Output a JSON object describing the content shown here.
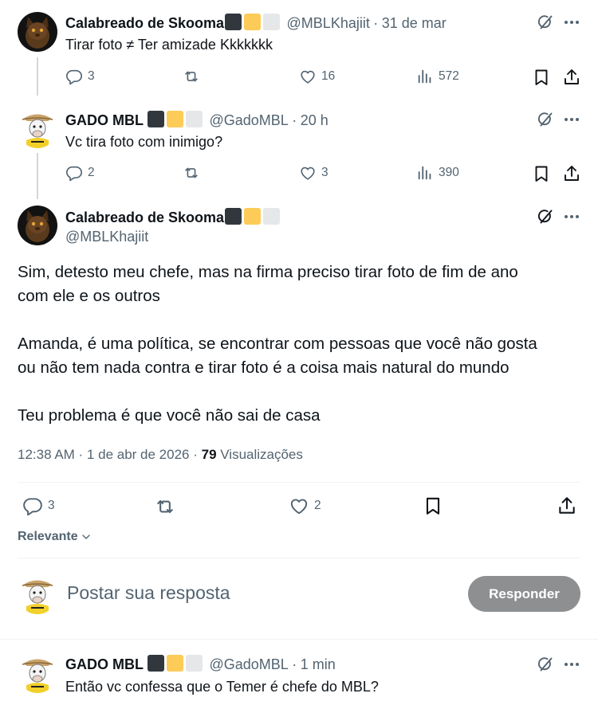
{
  "tweets": [
    {
      "author": "Calabreado de Skooma",
      "handle": "@MBLKhajiit",
      "dot": "·",
      "time": "31 de mar",
      "text": "Tirar foto ≠ Ter amizade Kkkkkkk",
      "replies": "3",
      "likes": "16",
      "views": "572"
    },
    {
      "author": "GADO MBL",
      "handle": "@GadoMBL",
      "dot": "·",
      "time": "20 h",
      "text": "Vc tira foto com inimigo?",
      "replies": "2",
      "likes": "3",
      "views": "390"
    }
  ],
  "main_tweet": {
    "author": "Calabreado de Skooma",
    "handle": "@MBLKhajiit",
    "paragraph1_line1": "Sim, detesto meu chefe, mas na firma preciso tirar foto de fim de ano",
    "paragraph1_line2": "com ele e os outros",
    "paragraph2_line1": "Amanda, é uma política, se encontrar com pessoas que você não gosta",
    "paragraph2_line2": "ou não tem nada contra e tirar foto é a coisa mais natural do mundo",
    "paragraph3": "Teu problema é que você não sai de casa",
    "timestamp": "12:38 AM · 1 de abr de 2026 · ",
    "views_count": "79",
    "views_label": " Visualizações",
    "replies": "3",
    "likes": "2"
  },
  "sort": {
    "label": "Relevante"
  },
  "composer": {
    "placeholder": "Postar sua resposta",
    "button": "Responder"
  },
  "reply": {
    "author": "GADO MBL",
    "handle": "@GadoMBL",
    "dot": "·",
    "time": "1 min",
    "text": "Então vc confessa que o Temer é chefe do MBL?"
  },
  "colors": {
    "text": "#0f1419",
    "secondary": "#536471",
    "divider": "#eff3f4",
    "reply_button": "#8d8f91",
    "flag_dark": "#31373d",
    "flag_yellow": "#fdcb58",
    "flag_light": "#e6e7e8"
  }
}
